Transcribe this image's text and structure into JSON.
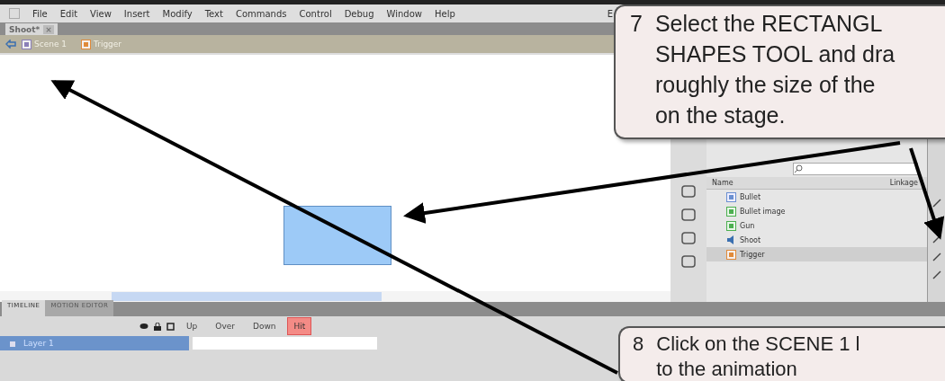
{
  "menu_bar": {
    "items": [
      "File",
      "Edit",
      "View",
      "Insert",
      "Modify",
      "Text",
      "Commands",
      "Control",
      "Debug",
      "Window",
      "Help"
    ],
    "cut_item": "E"
  },
  "document_tab": {
    "title": "Shoot*",
    "close": "×"
  },
  "breadcrumb": [
    {
      "label": "Scene 1",
      "kind": "scene"
    },
    {
      "label": "Trigger",
      "kind": "button"
    }
  ],
  "library": {
    "columns": [
      "Name",
      "Linkage"
    ],
    "items": [
      {
        "name": "Bullet",
        "kind": "movieclip",
        "selected": false
      },
      {
        "name": "Bullet image",
        "kind": "graphic",
        "selected": false
      },
      {
        "name": "Gun",
        "kind": "graphic",
        "selected": false
      },
      {
        "name": "Shoot",
        "kind": "sound",
        "selected": false
      },
      {
        "name": "Trigger",
        "kind": "button",
        "selected": true
      }
    ]
  },
  "timeline": {
    "tabs": [
      {
        "label": "TIMELINE",
        "selected": true
      },
      {
        "label": "MOTION EDITOR",
        "selected": false
      }
    ],
    "frames": [
      {
        "label": "Up",
        "selected": false
      },
      {
        "label": "Over",
        "selected": false
      },
      {
        "label": "Down",
        "selected": false
      },
      {
        "label": "Hit",
        "selected": true
      }
    ],
    "layers": [
      {
        "name": "Layer 1",
        "selected": true
      }
    ]
  },
  "callouts": [
    {
      "number": "7",
      "lines": [
        "Select the RECTANGL",
        "SHAPES TOOL and dra",
        "roughly the size of the",
        "on the stage."
      ]
    },
    {
      "number": "8",
      "lines": [
        "Click on the SCENE 1 l",
        "to the animation"
      ]
    }
  ]
}
